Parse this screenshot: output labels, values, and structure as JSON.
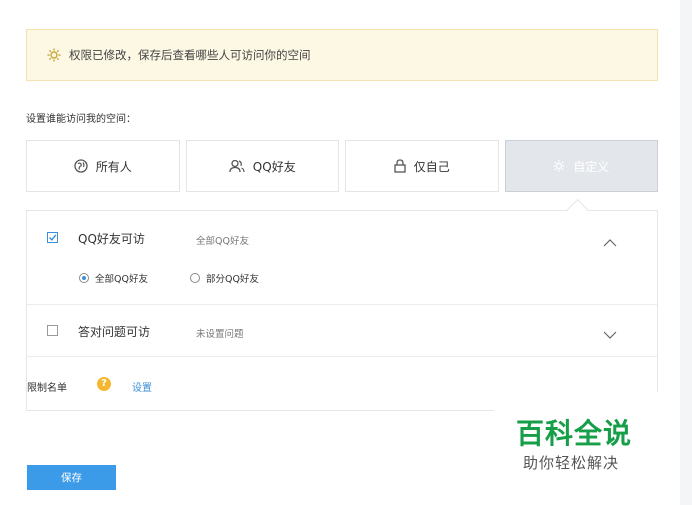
{
  "notice": {
    "text": "权限已修改，保存后查看哪些人可访问你的空间",
    "icon": "gear-icon"
  },
  "section_label": "设置谁能访问我的空间：",
  "access_options": [
    {
      "label": "所有人",
      "icon": "globe-icon",
      "selected": false
    },
    {
      "label": "QQ好友",
      "icon": "friends-icon",
      "selected": false
    },
    {
      "label": "仅自己",
      "icon": "lock-icon",
      "selected": false
    },
    {
      "label": "自定义",
      "icon": "gear-icon",
      "selected": true
    }
  ],
  "custom_panel": {
    "qq_friends": {
      "title": "QQ好友可访",
      "desc": "全部QQ好友",
      "checked": true,
      "expanded": true,
      "radios": [
        {
          "label": "全部QQ好友",
          "selected": true
        },
        {
          "label": "部分QQ好友",
          "selected": false
        }
      ]
    },
    "answer_question": {
      "title": "答对问题可访",
      "desc": "未设置问题",
      "checked": false,
      "expanded": false
    },
    "blocklist": {
      "label": "限制名单",
      "link": "设置"
    }
  },
  "save_button": "保存",
  "watermark": {
    "title": "百科全说",
    "subtitle": "助你轻松解决"
  },
  "colors": {
    "accent": "#3c9be8",
    "notice_bg": "#fdf8e4",
    "watermark_green": "#169e48",
    "help_icon": "#f5b731"
  }
}
